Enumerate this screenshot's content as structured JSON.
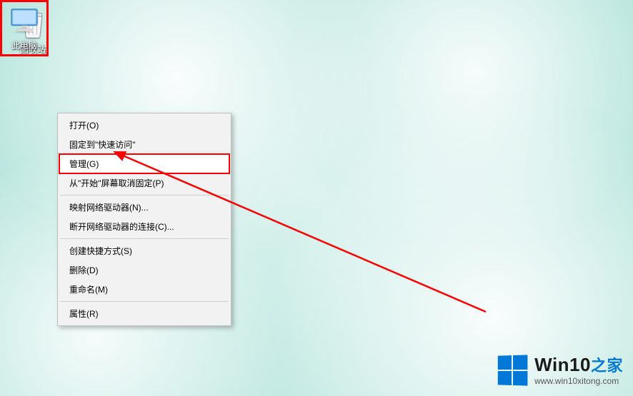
{
  "desktop": {
    "recycle_bin_label": "回收站",
    "this_pc_label": "此电脑"
  },
  "context_menu": {
    "open": "打开(O)",
    "pin_quick_access": "固定到\"快速访问\"",
    "manage": "管理(G)",
    "unpin_start": "从\"开始\"屏幕取消固定(P)",
    "map_network_drive": "映射网络驱动器(N)...",
    "disconnect_network_drive": "断开网络驱动器的连接(C)...",
    "create_shortcut": "创建快捷方式(S)",
    "delete": "删除(D)",
    "rename": "重命名(M)",
    "properties": "属性(R)"
  },
  "watermark": {
    "title_pre": "Win10",
    "title_zhi": "之家",
    "url": "www.win10xitong.com"
  },
  "annotation": {
    "highlight_color": "#ff0000"
  }
}
